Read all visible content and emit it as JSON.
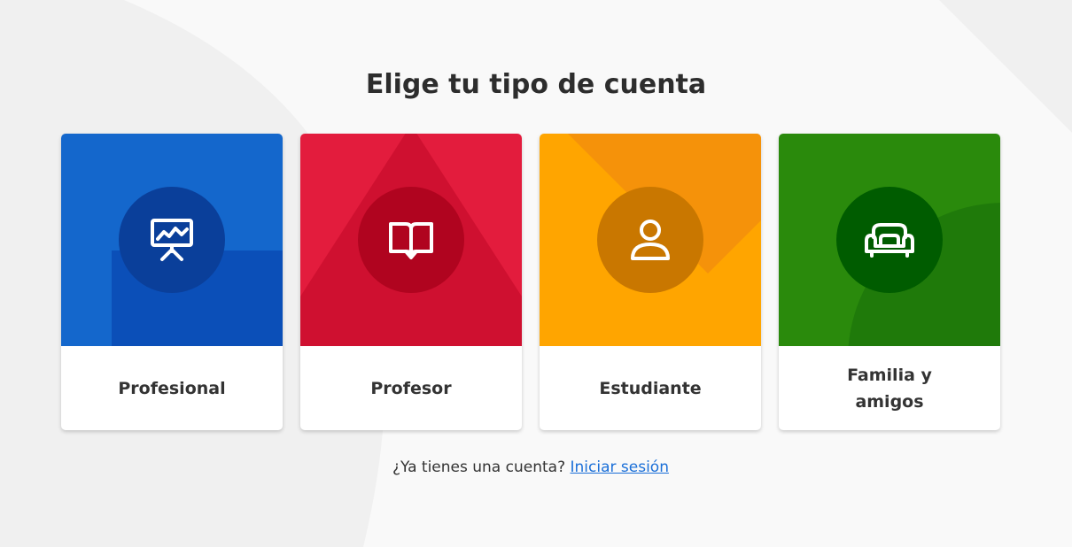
{
  "page": {
    "title": "Elige tu tipo de cuenta"
  },
  "cards": [
    {
      "label": "Profesional",
      "icon": "presentation-board-icon",
      "color": "#1467cc",
      "accent": "#0b4fb8",
      "circle": "#0a3f9a"
    },
    {
      "label": "Profesor",
      "icon": "open-book-icon",
      "color": "#e31c3d",
      "accent": "#cf1030",
      "circle": "#b0041f"
    },
    {
      "label": "Estudiante",
      "icon": "user-icon",
      "color": "#ffa500",
      "accent": "#f5920a",
      "circle": "#c97700"
    },
    {
      "label": "Familia y amigos",
      "icon": "sofa-icon",
      "color": "#2a8a0c",
      "accent": "#1f7a0a",
      "circle": "#005c00"
    }
  ],
  "login": {
    "prompt": "¿Ya tienes una cuenta?",
    "link_label": "Iniciar sesión",
    "link_color": "#1a6fd8"
  }
}
